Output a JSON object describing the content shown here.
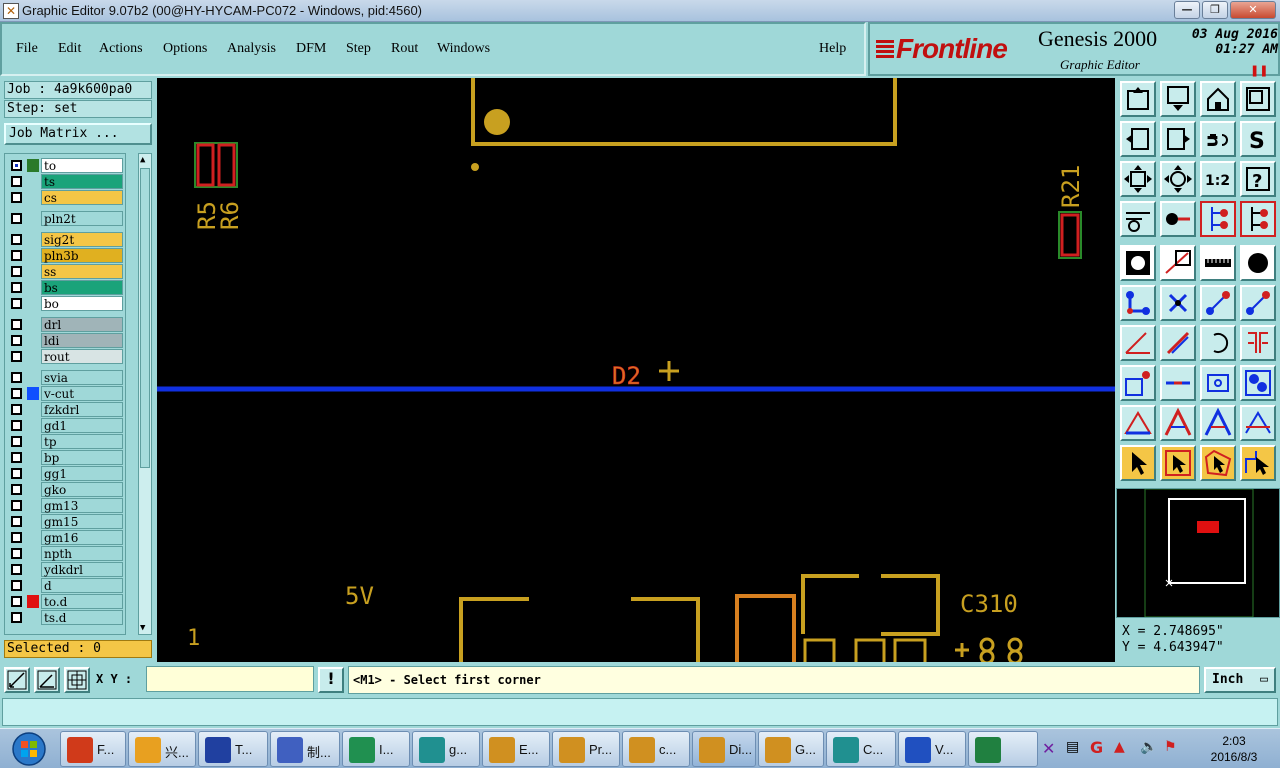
{
  "window": {
    "title": "Graphic Editor 9.07b2 (00@HY-HYCAM-PC072 - Windows, pid:4560)",
    "minimize_glyph": "—",
    "restore_glyph": "❐",
    "close_glyph": "✕"
  },
  "menu": {
    "items": [
      "File",
      "Edit",
      "Actions",
      "Options",
      "Analysis",
      "DFM",
      "Step",
      "Rout",
      "Windows"
    ],
    "help": "Help"
  },
  "logo": {
    "brand": "Frontline",
    "product": "Genesis 2000",
    "subtitle": "Graphic Editor",
    "date": "03 Aug 2016",
    "time": "01:27 AM"
  },
  "job": {
    "job_label": "Job : 4a9k600pa0",
    "step_label": "Step: set",
    "matrix_button": "Job Matrix ..."
  },
  "layers": [
    {
      "name": "to",
      "color": "#2a7a2a",
      "bg": "#ffffff",
      "checked_color": "#1030c0"
    },
    {
      "name": "ts",
      "color": "",
      "bg": "#1aa37a"
    },
    {
      "name": "cs",
      "color": "",
      "bg": "#f4c646"
    },
    {
      "name": "pln2t",
      "color": "",
      "bg": "#9fd8d8"
    },
    {
      "name": "sig2t",
      "color": "",
      "bg": "#f4c646"
    },
    {
      "name": "pln3b",
      "color": "",
      "bg": "#e0b020"
    },
    {
      "name": "ss",
      "color": "",
      "bg": "#f4c646"
    },
    {
      "name": "bs",
      "color": "",
      "bg": "#1aa37a"
    },
    {
      "name": "bo",
      "color": "",
      "bg": "#ffffff"
    },
    {
      "name": "drl",
      "color": "",
      "bg": "#a0b4b8"
    },
    {
      "name": "ldi",
      "color": "",
      "bg": "#a0b4b8"
    },
    {
      "name": "rout",
      "color": "",
      "bg": "#d8e4e4"
    },
    {
      "name": "svia",
      "color": "",
      "bg": "#9fd8d8"
    },
    {
      "name": "v-cut",
      "color": "#1050ff",
      "bg": "#9fd8d8"
    },
    {
      "name": "fzkdrl",
      "color": "",
      "bg": "#9fd8d8"
    },
    {
      "name": "gd1",
      "color": "",
      "bg": "#9fd8d8"
    },
    {
      "name": "tp",
      "color": "",
      "bg": "#9fd8d8"
    },
    {
      "name": "bp",
      "color": "",
      "bg": "#9fd8d8"
    },
    {
      "name": "gg1",
      "color": "",
      "bg": "#9fd8d8"
    },
    {
      "name": "gko",
      "color": "",
      "bg": "#9fd8d8"
    },
    {
      "name": "gm13",
      "color": "",
      "bg": "#9fd8d8"
    },
    {
      "name": "gm15",
      "color": "",
      "bg": "#9fd8d8"
    },
    {
      "name": "gm16",
      "color": "",
      "bg": "#9fd8d8"
    },
    {
      "name": "npth",
      "color": "",
      "bg": "#9fd8d8"
    },
    {
      "name": "ydkdrl",
      "color": "",
      "bg": "#9fd8d8"
    },
    {
      "name": "d",
      "color": "",
      "bg": "#9fd8d8"
    },
    {
      "name": "to.d",
      "color": "#e01010",
      "bg": "#9fd8d8"
    },
    {
      "name": "ts.d",
      "color": "",
      "bg": "#9fd8d8"
    }
  ],
  "selected_label": "Selected : 0",
  "canvas": {
    "labels": {
      "r5": "R5",
      "r6": "R6",
      "r21": "R21",
      "d2": "D2",
      "v5": "5V",
      "c310": "C310",
      "one": "1"
    },
    "colors": {
      "silk": "#c8a020",
      "pad_red": "#d02020",
      "pad_green": "#2a8a2a",
      "vcut": "#1030e0",
      "orange": "#d88020"
    }
  },
  "coords": {
    "x": "X = 2.748695\"",
    "y": "Y = 4.643947\""
  },
  "command": {
    "xy_label": "X Y :",
    "xy_value": "",
    "prompt": "<M1> - Select first corner",
    "unit": "Inch"
  },
  "taskbar": {
    "tasks": [
      {
        "label": "F...",
        "color": "#d03a1a"
      },
      {
        "label": "兴...",
        "color": "#e8a020"
      },
      {
        "label": "T...",
        "color": "#2040a0"
      },
      {
        "label": "制...",
        "color": "#4060c0"
      },
      {
        "label": "I...",
        "color": "#209050"
      },
      {
        "label": "g...",
        "color": "#209090"
      },
      {
        "label": "E...",
        "color": "#d09020"
      },
      {
        "label": "Pr...",
        "color": "#d09020"
      },
      {
        "label": "c...",
        "color": "#d09020"
      },
      {
        "label": "Di...",
        "color": "#d09020"
      },
      {
        "label": "G...",
        "color": "#d09020"
      },
      {
        "label": "C...",
        "color": "#209090"
      },
      {
        "label": "V...",
        "color": "#2050c0"
      },
      {
        "label": "",
        "color": "#208040"
      }
    ],
    "clock_time": "2:03",
    "clock_date": "2016/8/3"
  }
}
